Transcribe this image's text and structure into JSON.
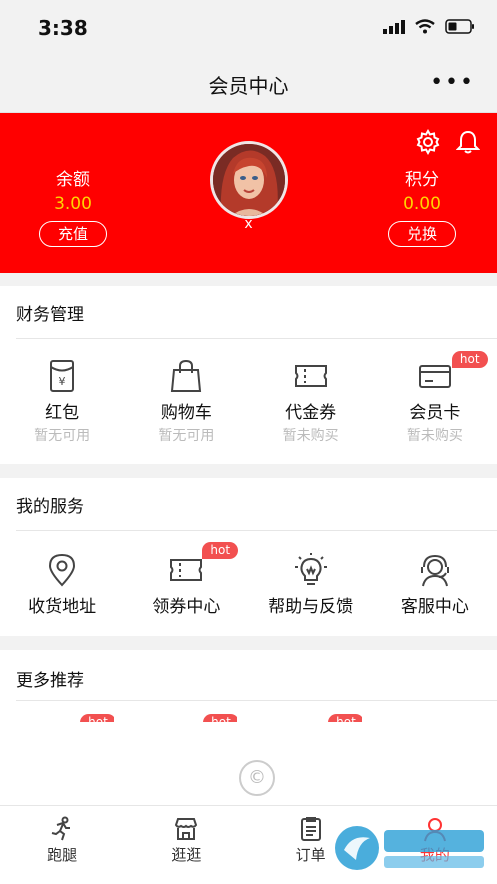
{
  "status": {
    "time": "3:38"
  },
  "nav": {
    "title": "会员中心",
    "more": "•••"
  },
  "profile": {
    "balance_label": "余额",
    "balance_value": "3.00",
    "recharge_label": "充值",
    "points_label": "积分",
    "points_value": "0.00",
    "exchange_label": "兑换",
    "username": "x"
  },
  "finance": {
    "title": "财务管理",
    "items": [
      {
        "label": "红包",
        "sub": "暂无可用",
        "icon": "red-packet-icon"
      },
      {
        "label": "购物车",
        "sub": "暂无可用",
        "icon": "shopping-bag-icon"
      },
      {
        "label": "代金券",
        "sub": "暂未购买",
        "icon": "voucher-icon"
      },
      {
        "label": "会员卡",
        "sub": "暂未购买",
        "icon": "member-card-icon",
        "badge": "hot"
      }
    ]
  },
  "services": {
    "title": "我的服务",
    "items": [
      {
        "label": "收货地址",
        "icon": "location-pin-icon"
      },
      {
        "label": "领券中心",
        "icon": "coupon-ticket-icon",
        "badge": "hot"
      },
      {
        "label": "帮助与反馈",
        "icon": "lightbulb-icon"
      },
      {
        "label": "客服中心",
        "icon": "headset-agent-icon"
      }
    ]
  },
  "recommend": {
    "title": "更多推荐",
    "badge": "hot"
  },
  "copyright_symbol": "©",
  "tabs": [
    {
      "label": "跑腿",
      "icon": "runner-icon"
    },
    {
      "label": "逛逛",
      "icon": "shop-icon"
    },
    {
      "label": "订单",
      "icon": "order-list-icon"
    },
    {
      "label": "我的",
      "icon": "profile-icon"
    }
  ],
  "colors": {
    "brand_red": "#ff0000",
    "value_yellow": "#ffd400",
    "hot_badge": "#f25050"
  }
}
